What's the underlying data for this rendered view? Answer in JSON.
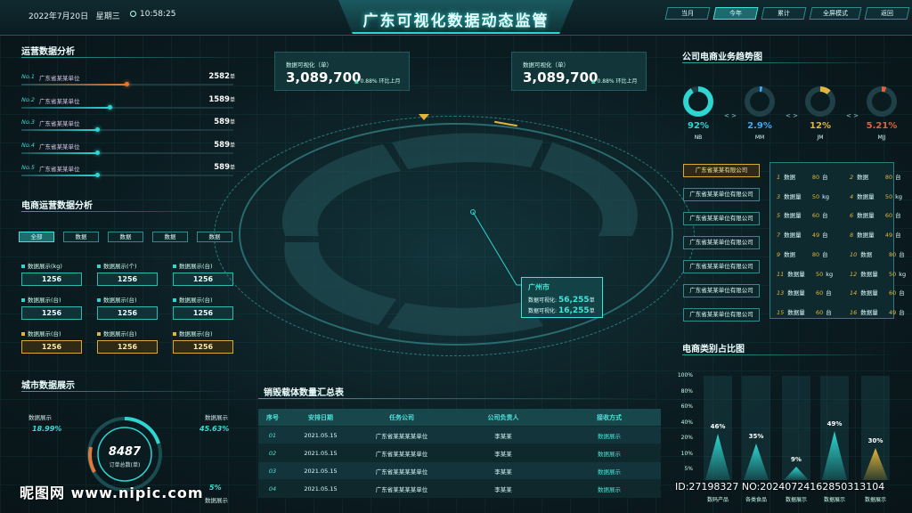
{
  "header": {
    "date": "2022年7月20日",
    "weekday": "星期三",
    "time": "10:58:25",
    "title": "广东可视化数据动态监管",
    "tabs": [
      {
        "label": "当月",
        "active": false
      },
      {
        "label": "今年",
        "active": true
      },
      {
        "label": "累计",
        "active": false
      },
      {
        "label": "全屏模式",
        "active": false
      },
      {
        "label": "返回",
        "active": false
      }
    ]
  },
  "ops": {
    "title": "运营数据分析",
    "rows": [
      {
        "no": "No.1",
        "name": "广东省某某单位",
        "value": "2582",
        "unit": "单",
        "fill": 0.5,
        "color": "#e07a3a"
      },
      {
        "no": "No.2",
        "name": "广东省某某单位",
        "value": "1589",
        "unit": "单",
        "fill": 0.42,
        "color": "#2fd5d0"
      },
      {
        "no": "No.3",
        "name": "广东省某某单位",
        "value": "589",
        "unit": "单",
        "fill": 0.36,
        "color": "#2fd5d0"
      },
      {
        "no": "No.4",
        "name": "广东省某某单位",
        "value": "589",
        "unit": "单",
        "fill": 0.36,
        "color": "#2fd5d0"
      },
      {
        "no": "No.5",
        "name": "广东省某某单位",
        "value": "589",
        "unit": "单",
        "fill": 0.36,
        "color": "#2fd5d0"
      }
    ]
  },
  "ecom": {
    "title": "电商运营数据分析",
    "filters": [
      "全部",
      "数据",
      "数据",
      "数据",
      "数据"
    ],
    "stats": [
      {
        "label": "数据展示(kg)",
        "value": "1256",
        "style": "teal"
      },
      {
        "label": "数据展示(个)",
        "value": "1256",
        "style": "teal"
      },
      {
        "label": "数据展示(台)",
        "value": "1256",
        "style": "teal"
      },
      {
        "label": "数据展示(台)",
        "value": "1256",
        "style": "teal"
      },
      {
        "label": "数据展示(台)",
        "value": "1256",
        "style": "teal"
      },
      {
        "label": "数据展示(台)",
        "value": "1256",
        "style": "teal"
      },
      {
        "label": "数据展示(台)",
        "value": "1256",
        "style": "gold"
      },
      {
        "label": "数据展示(台)",
        "value": "1256",
        "style": "gold"
      },
      {
        "label": "数据展示(台)",
        "value": "1256",
        "style": "gold"
      }
    ]
  },
  "city": {
    "title": "城市数据展示",
    "left_label": "数据展示",
    "left_value": "18.99%",
    "right_label": "数据展示",
    "right_value": "45.63%",
    "center_value": "8487",
    "center_label": "订单总数(单)",
    "bottom_right_label": "数据展示",
    "bottom_right_value": "5%"
  },
  "kpis": [
    {
      "label": "数据可视化（单）",
      "value": "3,089,700",
      "change": "0.88%",
      "change_label": "环比上月"
    },
    {
      "label": "数据可视化（单）",
      "value": "3,089,700",
      "change": "0.88%",
      "change_label": "环比上月"
    }
  ],
  "map_card": {
    "city": "广州市",
    "line1_label": "数据可视化:",
    "line1_value": "56,255",
    "line1_unit": "单",
    "line2_label": "数据可视化:",
    "line2_value": "16,255",
    "line2_unit": "单"
  },
  "table": {
    "title": "销毁载体数量汇总表",
    "headers": [
      "序号",
      "安排日期",
      "任务公司",
      "公司负责人",
      "接收方式"
    ],
    "rows": [
      [
        "01",
        "2021.05.15",
        "广东省某某某某单位",
        "李某某",
        "数据展示"
      ],
      [
        "02",
        "2021.05.15",
        "广东省某某某某单位",
        "李某某",
        "数据展示"
      ],
      [
        "03",
        "2021.05.15",
        "广东省某某某某单位",
        "李某某",
        "数据展示"
      ],
      [
        "04",
        "2021.05.15",
        "广东省某某某某单位",
        "李某某",
        "数据展示"
      ]
    ]
  },
  "trend": {
    "title": "公司电商业务趋势图",
    "donuts": [
      {
        "value": "92%",
        "label": "NB",
        "pct": 92,
        "color": "#2fd5d0"
      },
      {
        "value": "2.9%",
        "label": "MM",
        "pct": 3,
        "color": "#3fa9f5"
      },
      {
        "value": "12%",
        "label": "JM",
        "pct": 12,
        "color": "#e2b43a"
      },
      {
        "value": "5.21%",
        "label": "MJJ",
        "pct": 5,
        "color": "#e0623a"
      }
    ],
    "companies": [
      {
        "label": "广东省某某有限公司",
        "active": true
      },
      {
        "label": "广东省某某单位有限公司",
        "active": false
      },
      {
        "label": "广东省某某单位有限公司",
        "active": false
      },
      {
        "label": "广东省某某单位有限公司",
        "active": false
      },
      {
        "label": "广东省某某单位有限公司",
        "active": false
      },
      {
        "label": "广东省某某单位有限公司",
        "active": false
      },
      {
        "label": "广东省某某单位有限公司",
        "active": false
      }
    ],
    "grid": [
      [
        "1",
        "数据",
        "80",
        "台",
        "2",
        "数据",
        "80",
        "台"
      ],
      [
        "3",
        "数据量",
        "50",
        "kg",
        "4",
        "数据量",
        "50",
        "kg"
      ],
      [
        "5",
        "数据量",
        "60",
        "台",
        "6",
        "数据量",
        "60",
        "台"
      ],
      [
        "7",
        "数据量",
        "49",
        "台",
        "8",
        "数据量",
        "49",
        "台"
      ],
      [
        "9",
        "数据",
        "80",
        "台",
        "10",
        "数据",
        "80",
        "台"
      ],
      [
        "11",
        "数据量",
        "50",
        "kg",
        "12",
        "数据量",
        "50",
        "kg"
      ],
      [
        "13",
        "数据量",
        "60",
        "台",
        "14",
        "数据量",
        "60",
        "台"
      ],
      [
        "15",
        "数据量",
        "60",
        "台",
        "16",
        "数据量",
        "49",
        "台"
      ]
    ]
  },
  "share": {
    "title": "电商类别占比图",
    "y_ticks": [
      "100%",
      "80%",
      "60%",
      "40%",
      "20%",
      "10%",
      "5%"
    ],
    "chart_data": {
      "type": "bar",
      "title": "电商类别占比图",
      "categories": [
        "数码产品",
        "各类食品",
        "数据展示",
        "数据展示",
        "数据展示"
      ],
      "values": [
        46,
        35,
        9,
        49,
        30
      ],
      "labels": [
        "46%",
        "35%",
        "9%",
        "49%",
        "30%"
      ],
      "colors": [
        "#2fd5d0",
        "#2fd5d0",
        "#2fd5d0",
        "#2fd5d0",
        "#e2b43a"
      ],
      "ylim": [
        0,
        100
      ]
    }
  },
  "watermark": {
    "logo": "昵图网 www.nipic.com",
    "id": "ID:27198327 NO:20240724162850313104"
  }
}
